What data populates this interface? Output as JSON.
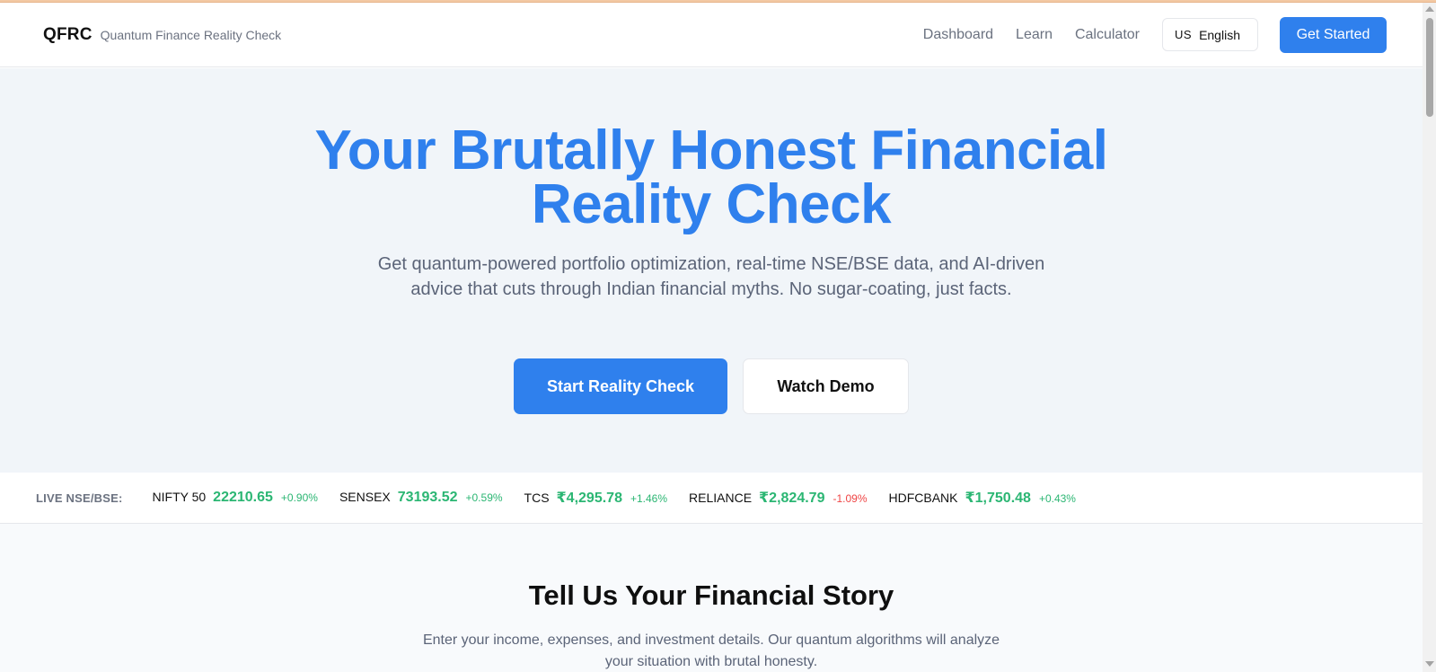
{
  "header": {
    "logo": "QFRC",
    "tagline": "Quantum Finance Reality Check",
    "nav": [
      {
        "label": "Dashboard"
      },
      {
        "label": "Learn"
      },
      {
        "label": "Calculator"
      }
    ],
    "language": {
      "flag": "US",
      "selected": "English"
    },
    "cta_label": "Get Started"
  },
  "hero": {
    "title_line1": "Your Brutally Honest Financial",
    "title_line2": "Reality Check",
    "description": "Get quantum-powered portfolio optimization, real-time NSE/BSE data, and AI-driven advice that cuts through Indian financial myths. No sugar-coating, just facts.",
    "primary_label": "Start Reality Check",
    "secondary_label": "Watch Demo"
  },
  "ticker": {
    "label": "LIVE NSE/BSE:",
    "items": [
      {
        "symbol": "NIFTY 50",
        "price": "22210.65",
        "change": "+0.90%"
      },
      {
        "symbol": "SENSEX",
        "price": "73193.52",
        "change": "+0.59%"
      },
      {
        "symbol": "TCS",
        "price": "₹4,295.78",
        "change": "+1.46%"
      },
      {
        "symbol": "RELIANCE",
        "price": "₹2,824.79",
        "change": "-1.09%"
      },
      {
        "symbol": "HDFCBANK",
        "price": "₹1,750.48",
        "change": "+0.43%"
      }
    ],
    "colors": {
      "positive": "#2bb673",
      "negative": "#ef4444"
    }
  },
  "story": {
    "title": "Tell Us Your Financial Story",
    "description": "Enter your income, expenses, and investment details. Our quantum algorithms will analyze your situation with brutal honesty."
  },
  "theme": {
    "accent": "#2f80ed"
  }
}
